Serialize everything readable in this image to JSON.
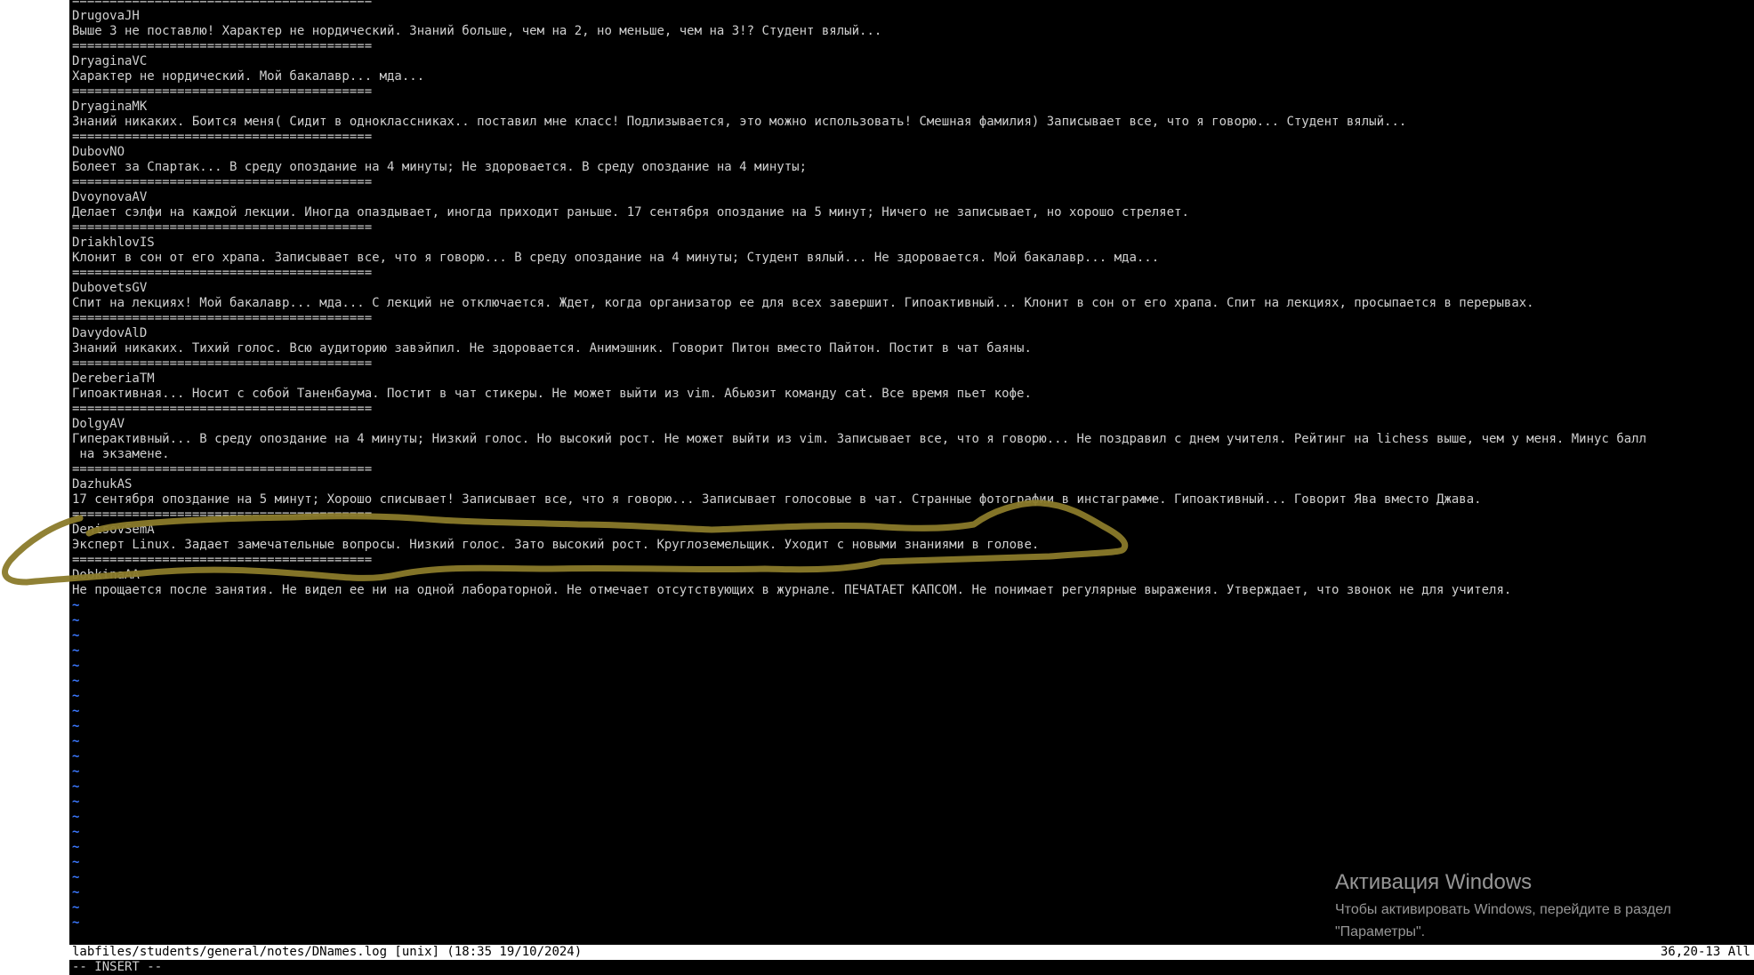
{
  "editor": {
    "mode": "-- INSERT --",
    "status_left": "labfiles/students/general/notes/DNames.log [unix] (18:35 19/10/2024)",
    "status_right": "36,20-13 All",
    "tilde": "~",
    "separator": "========================================",
    "entries": [
      {
        "name": "",
        "note": ""
      },
      {
        "name": "DrugovaJH",
        "note": "Выше 3 не поставлю! Характер не нордический. Знаний больше, чем на 2, но меньше, чем на 3!? Студент вялый..."
      },
      {
        "name": "DryaginaVC",
        "note": "Характер не нордический. Мой бакалавр... мда..."
      },
      {
        "name": "DryaginaMK",
        "note": "Знаний никаких. Боится меня( Сидит в одноклассниках.. поставил мне класс! Подлизывается, это можно использовать! Смешная фамилия) Записывает все, что я говорю... Студент вялый..."
      },
      {
        "name": "DubovNO",
        "note": "Болеет за Спартак... В среду опоздание на 4 минуты; Не здоровается. В среду опоздание на 4 минуты;"
      },
      {
        "name": "DvoynovaAV",
        "note": "Делает сэлфи на каждой лекции. Иногда опаздывает, иногда приходит раньше. 17 сентября опоздание на 5 минут; Ничего не записывает, но хорошо стреляет."
      },
      {
        "name": "DriakhlovIS",
        "note": "Клонит в сон от его храпа. Записывает все, что я говорю... В среду опоздание на 4 минуты; Студент вялый... Не здоровается. Мой бакалавр... мда..."
      },
      {
        "name": "DubovetsGV",
        "note": "Спит на лекциях! Мой бакалавр... мда... С лекций не отключается. Ждет, когда организатор ее для всех завершит. Гипоактивный... Клонит в сон от его храпа. Спит на лекциях, просыпается в перерывах."
      },
      {
        "name": "DavydovAlD",
        "note": "Знаний никаких. Тихий голос. Всю аудиторию завэйпил. Не здоровается. Анимэшник. Говорит Питон вместо Пайтон. Постит в чат баяны."
      },
      {
        "name": "DereberiaTM",
        "note": "Гипоактивная... Носит с собой Таненбаума. Постит в чат стикеры. Не может выйти из vim. Абьюзит команду cat. Все время пьет кофе."
      },
      {
        "name": "DolgyAV",
        "note": "Гиперактивный... В среду опоздание на 4 минуты; Низкий голос. Но высокий рост. Не может выйти из vim. Записывает все, что я говорю... Не поздравил с днем учителя. Рейтинг на lichess выше, чем у меня. Минус балл",
        "note_wrap": " на экзамене."
      },
      {
        "name": "DazhukAS",
        "note": "17 сентября опоздание на 5 минут; Хорошо списывает! Записывает все, что я говорю... Записывает голосовые в чат. Странные фотографии в инстаграмме. Гипоактивный... Говорит Ява вместо Джава."
      },
      {
        "name": "DenisovSemA",
        "note": "Эксперт Linux. Задает замечательные вопросы. Низкий голос. Зато высокий рост. Круглоземельщик. Уходит с новыми знаниями в голове."
      },
      {
        "name": "DobkinaAA",
        "note": "Не прощается после занятия. Не видел ее ни на одной лабораторной. Не отмечает отсутствующих в журнале. ПЕЧАТАЕТ КАПСОМ. Не понимает регулярные выражения. Утверждает, что звонок не для учителя."
      }
    ],
    "tilde_count": 22
  },
  "watermark": {
    "title": "Активация Windows",
    "line1": "Чтобы активировать Windows, перейдите в раздел",
    "line2": "\"Параметры\"."
  },
  "annotation": {
    "color": "#8a7a2a"
  }
}
